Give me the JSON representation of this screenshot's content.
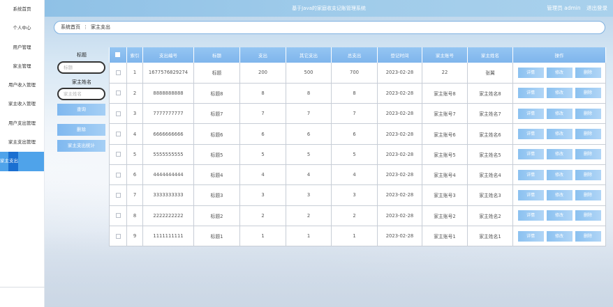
{
  "topbar": {
    "title": "基于Java的家庭收支记账管理系统",
    "user": "管理员 admin",
    "logout": "退出登录"
  },
  "sidebar": {
    "items": [
      {
        "label": "系统首页",
        "active": false
      },
      {
        "label": "个人中心",
        "active": false
      },
      {
        "label": "用户管理",
        "active": false
      },
      {
        "label": "家主管理",
        "active": false
      },
      {
        "label": "用户收入管理",
        "active": false
      },
      {
        "label": "家主收入管理",
        "active": false
      },
      {
        "label": "用户支出管理",
        "active": false
      },
      {
        "label": "家主支出管理",
        "active": false
      },
      {
        "label": "家主支出",
        "active": true
      }
    ]
  },
  "breadcrumb": {
    "home": "系统首页",
    "separator": "⋮",
    "current": "家主支出"
  },
  "filters": {
    "title_label": "标题",
    "title_placeholder": "标题",
    "name_label": "家主姓名",
    "name_placeholder": "家主姓名",
    "search_button": "查询",
    "delete_button": "删除",
    "stats_button": "家主支出统计"
  },
  "table": {
    "headers": [
      "索引",
      "支出编号",
      "标题",
      "支出",
      "其它支出",
      "总支出",
      "登记时间",
      "家主账号",
      "家主姓名",
      "操作"
    ],
    "actions": {
      "detail": "详情",
      "edit": "修改",
      "delete": "删除"
    },
    "rows": [
      [
        "1",
        "1677576829274",
        "标题",
        "200",
        "500",
        "700",
        "2023-02-28",
        "22",
        "张翼"
      ],
      [
        "2",
        "8888888888",
        "标题8",
        "8",
        "8",
        "8",
        "2023-02-28",
        "家主账号8",
        "家主姓名8"
      ],
      [
        "3",
        "7777777777",
        "标题7",
        "7",
        "7",
        "7",
        "2023-02-28",
        "家主账号7",
        "家主姓名7"
      ],
      [
        "4",
        "6666666666",
        "标题6",
        "6",
        "6",
        "6",
        "2023-02-28",
        "家主账号6",
        "家主姓名6"
      ],
      [
        "5",
        "5555555555",
        "标题5",
        "5",
        "5",
        "5",
        "2023-02-28",
        "家主账号5",
        "家主姓名5"
      ],
      [
        "6",
        "4444444444",
        "标题4",
        "4",
        "4",
        "4",
        "2023-02-28",
        "家主账号4",
        "家主姓名4"
      ],
      [
        "7",
        "3333333333",
        "标题3",
        "3",
        "3",
        "3",
        "2023-02-28",
        "家主账号3",
        "家主姓名3"
      ],
      [
        "8",
        "2222222222",
        "标题2",
        "2",
        "2",
        "2",
        "2023-02-28",
        "家主账号2",
        "家主姓名2"
      ],
      [
        "9",
        "1111111111",
        "标题1",
        "1",
        "1",
        "1",
        "2023-02-28",
        "家主账号1",
        "家主姓名1"
      ]
    ]
  },
  "colors": {
    "accent": "#4fa3ea",
    "header": "#8fc1e6",
    "button": "#8bc1f0"
  }
}
